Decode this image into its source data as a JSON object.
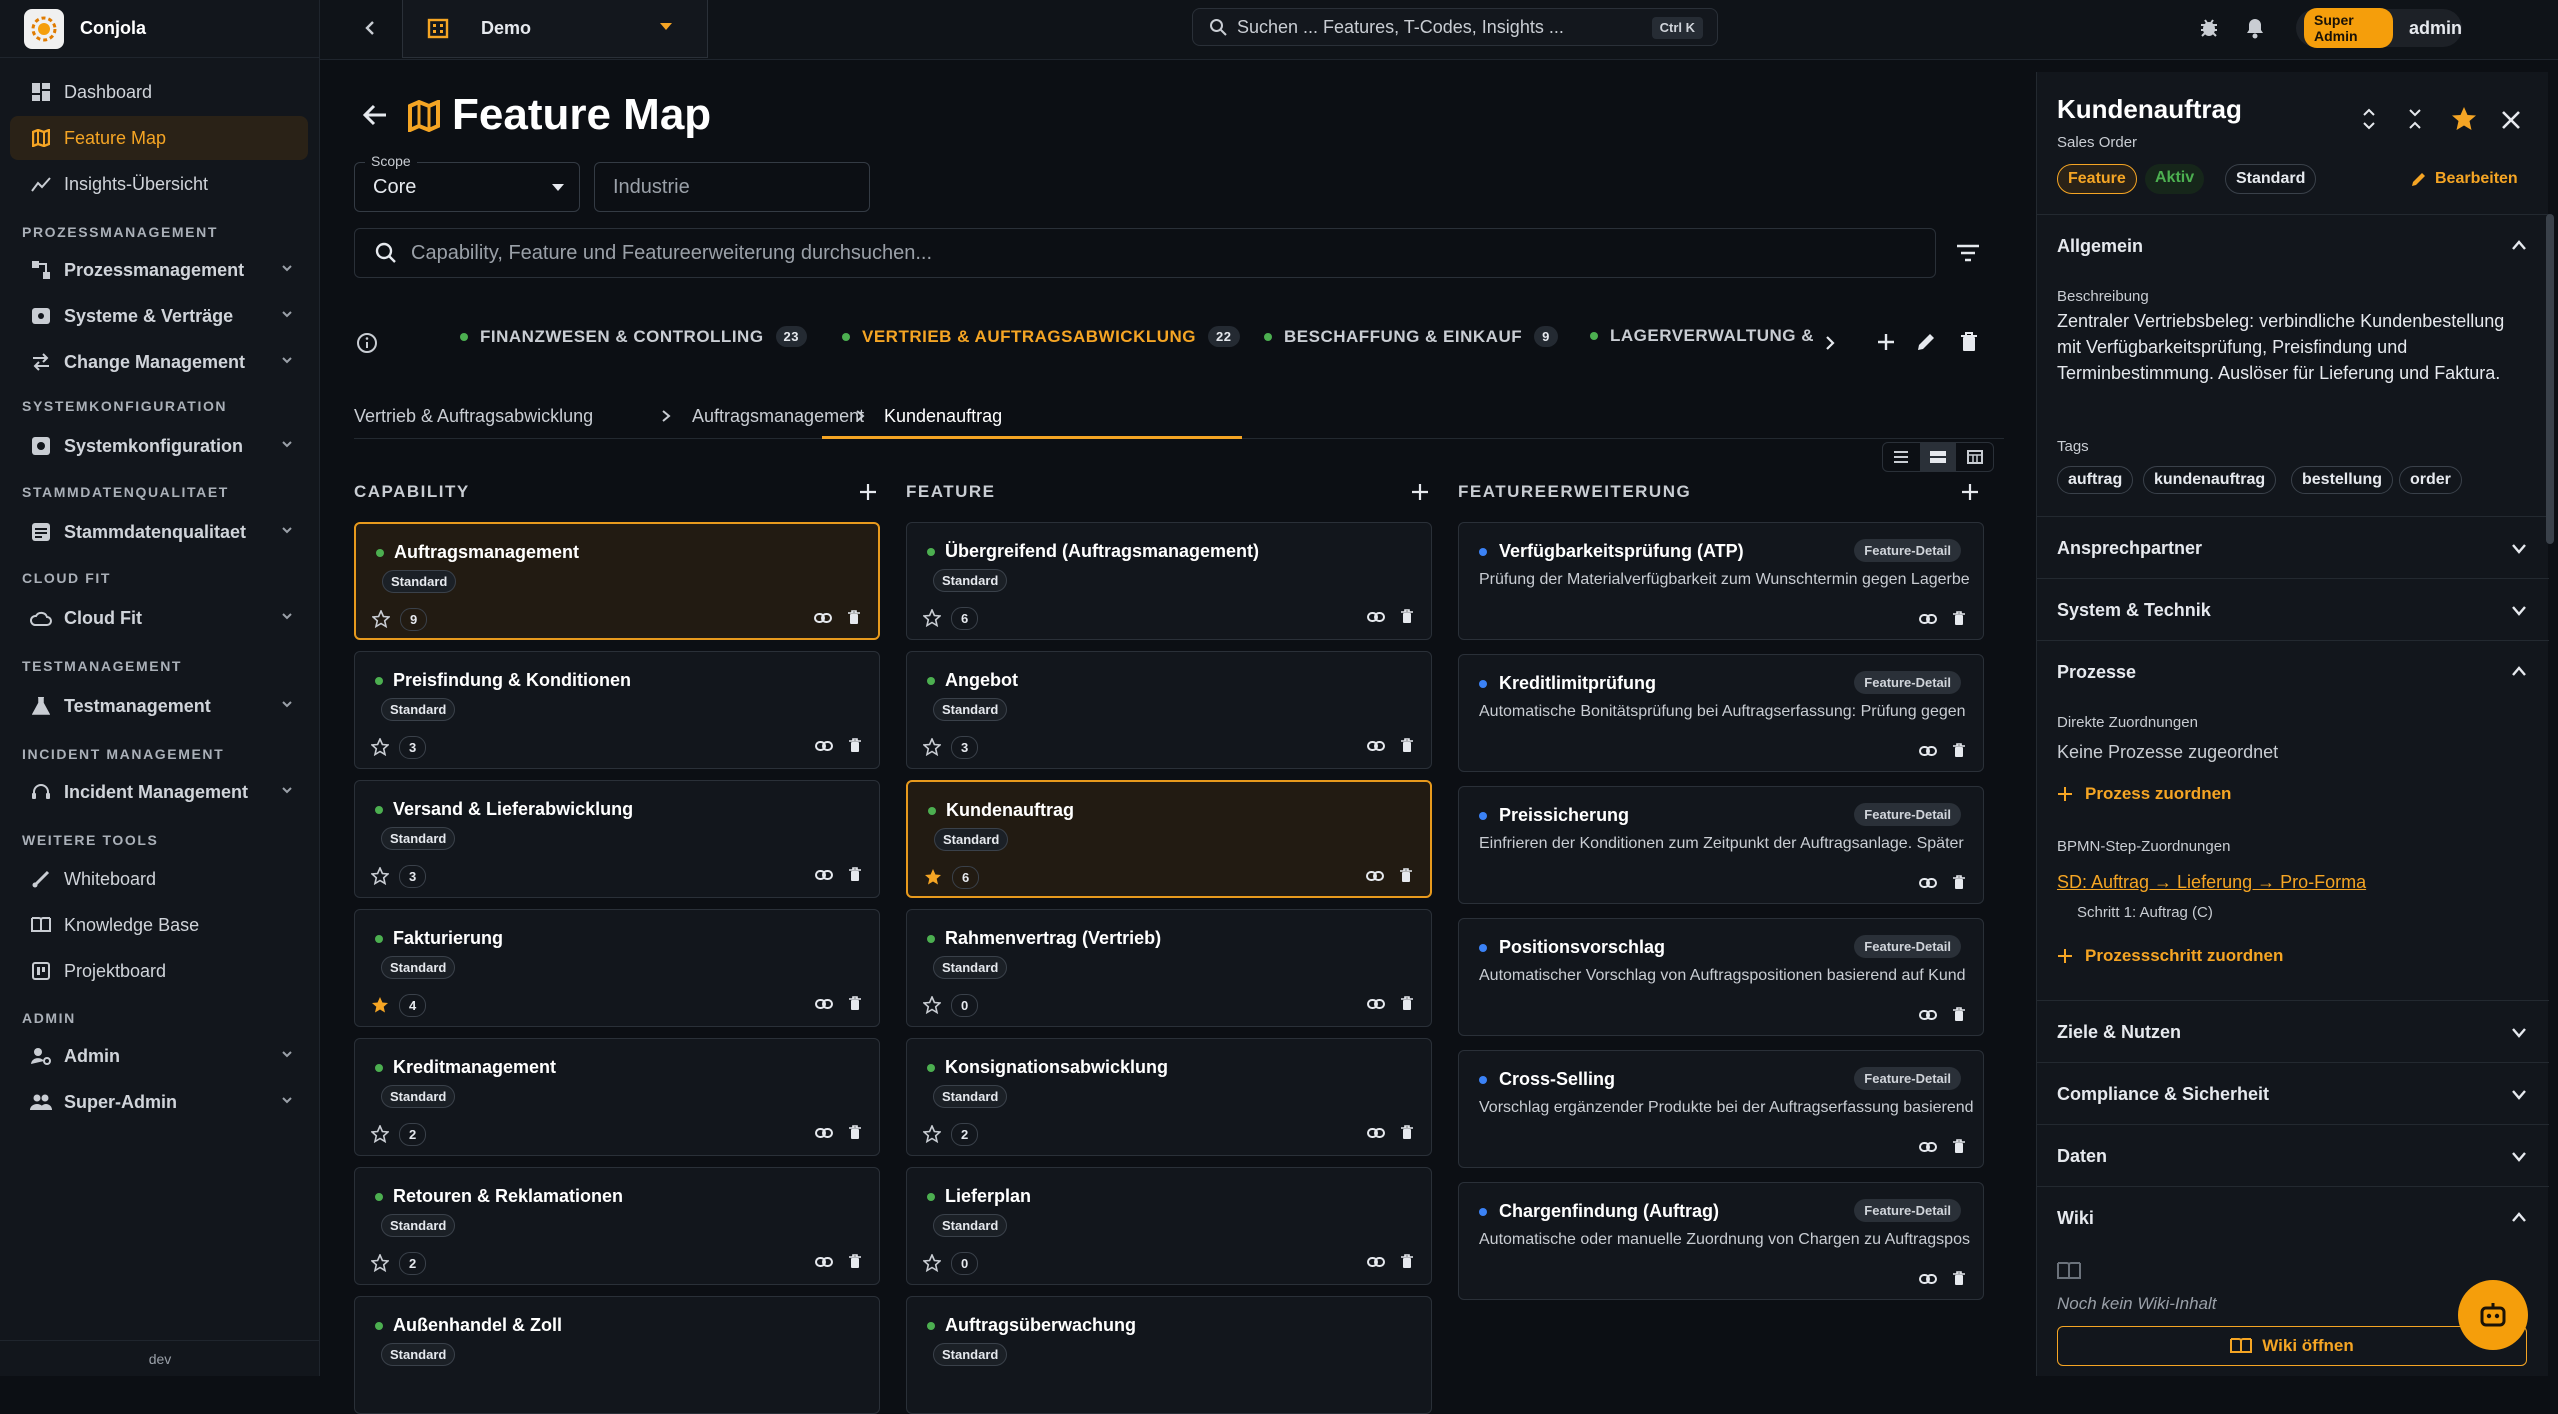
{
  "app": {
    "brand": "Conjola",
    "env": "dev"
  },
  "sidebar": {
    "top": [
      {
        "label": "Dashboard",
        "icon": "dashboard-icon"
      },
      {
        "label": "Feature Map",
        "icon": "map-icon"
      },
      {
        "label": "Insights-Übersicht",
        "icon": "chart-line-icon"
      }
    ],
    "sections": [
      {
        "title": "PROZESSMANAGEMENT",
        "item": "Prozessmanagement"
      },
      {
        "title": "",
        "item": "Systeme & Verträge"
      },
      {
        "title": "",
        "item": "Change Management"
      },
      {
        "title": "SYSTEMKONFIGURATION",
        "item": "Systemkonfiguration"
      },
      {
        "title": "STAMMDATENQUALITAET",
        "item": "Stammdatenqualitaet"
      },
      {
        "title": "CLOUD FIT",
        "item": "Cloud Fit"
      },
      {
        "title": "TESTMANAGEMENT",
        "item": "Testmanagement"
      },
      {
        "title": "INCIDENT MANAGEMENT",
        "item": "Incident Management"
      }
    ],
    "tools_title": "WEITERE TOOLS",
    "tools": [
      "Whiteboard",
      "Knowledge Base",
      "Projektboard"
    ],
    "admin_title": "ADMIN",
    "admin": [
      "Admin",
      "Super-Admin"
    ]
  },
  "topbar": {
    "workspace": "Demo",
    "search_placeholder": "Suchen ... Features, T-Codes, Insights ...",
    "shortcut": "Ctrl K",
    "role": "Super Admin",
    "user": "admin"
  },
  "page": {
    "title": "Feature Map",
    "scope_label": "Scope",
    "scope_value": "Core",
    "industry_placeholder": "Industrie",
    "search_placeholder": "Capability, Feature und Featureerweiterung durchsuchen...",
    "tabs": [
      {
        "label": "FINANZWESEN & CONTROLLING",
        "count": "23"
      },
      {
        "label": "VERTRIEB & AUFTRAGSABWICKLUNG",
        "count": "22"
      },
      {
        "label": "BESCHAFFUNG & EINKAUF",
        "count": "9"
      },
      {
        "label": "LAGERVERWALTUNG &",
        "count": ""
      }
    ],
    "breadcrumb": [
      "Vertrieb & Auftragsabwicklung",
      "Auftragsmanagement",
      "Kundenauftrag"
    ],
    "columns": {
      "capability": "CAPABILITY",
      "feature": "FEATURE",
      "extension": "FEATUREERWEITERUNG"
    },
    "standard_label": "Standard",
    "feature_detail_label": "Feature-Detail"
  },
  "capabilities": [
    {
      "name": "Auftragsmanagement",
      "count": "9",
      "starred": false
    },
    {
      "name": "Preisfindung & Konditionen",
      "count": "3",
      "starred": false
    },
    {
      "name": "Versand & Lieferabwicklung",
      "count": "3",
      "starred": false
    },
    {
      "name": "Fakturierung",
      "count": "4",
      "starred": true
    },
    {
      "name": "Kreditmanagement",
      "count": "2",
      "starred": false
    },
    {
      "name": "Retouren & Reklamationen",
      "count": "2",
      "starred": false
    },
    {
      "name": "Außenhandel & Zoll",
      "count": "",
      "starred": false
    }
  ],
  "features": [
    {
      "name": "Übergreifend (Auftragsmanagement)",
      "count": "6",
      "starred": false
    },
    {
      "name": "Angebot",
      "count": "3",
      "starred": false
    },
    {
      "name": "Kundenauftrag",
      "count": "6",
      "starred": true
    },
    {
      "name": "Rahmenvertrag (Vertrieb)",
      "count": "0",
      "starred": false
    },
    {
      "name": "Konsignationsabwicklung",
      "count": "2",
      "starred": false
    },
    {
      "name": "Lieferplan",
      "count": "0",
      "starred": false
    },
    {
      "name": "Auftragsüberwachung",
      "count": "",
      "starred": false
    }
  ],
  "extensions": [
    {
      "name": "Verfügbarkeitsprüfung (ATP)",
      "desc": "Prüfung der Materialverfügbarkeit zum Wunschtermin gegen Lagerbe"
    },
    {
      "name": "Kreditlimitprüfung",
      "desc": "Automatische Bonitätsprüfung bei Auftragserfassung: Prüfung gegen"
    },
    {
      "name": "Preissicherung",
      "desc": "Einfrieren der Konditionen zum Zeitpunkt der Auftragsanlage. Später"
    },
    {
      "name": "Positionsvorschlag",
      "desc": "Automatischer Vorschlag von Auftragspositionen basierend auf Kund"
    },
    {
      "name": "Cross-Selling",
      "desc": "Vorschlag ergänzender Produkte bei der Auftragserfassung basierend"
    },
    {
      "name": "Chargenfindung (Auftrag)",
      "desc": "Automatische oder manuelle Zuordnung von Chargen zu Auftragspos"
    }
  ],
  "panel": {
    "title": "Kundenauftrag",
    "subtitle": "Sales Order",
    "chips": [
      "Feature",
      "Aktiv",
      "Standard"
    ],
    "edit": "Bearbeiten",
    "general": "Allgemein",
    "desc_label": "Beschreibung",
    "desc": "Zentraler Vertriebsbeleg: verbindliche Kundenbestellung mit Verfügbarkeitsprüfung, Preisfindung und Terminbestimmung. Auslöser für Lieferung und Faktura.",
    "tags_label": "Tags",
    "tags": [
      "auftrag",
      "kundenauftrag",
      "bestellung",
      "order"
    ],
    "contact": "Ansprechpartner",
    "system": "System & Technik",
    "processes": "Prozesse",
    "direct_label": "Direkte Zuordnungen",
    "no_processes": "Keine Prozesse zugeordnet",
    "assign_process": "Prozess zuordnen",
    "bpmn_label": "BPMN-Step-Zuordnungen",
    "bpmn_link": "SD: Auftrag → Lieferung → Pro-Forma",
    "bpmn_step": "Schritt 1: Auftrag (C)",
    "assign_step": "Prozessschritt zuordnen",
    "goals": "Ziele & Nutzen",
    "compliance": "Compliance & Sicherheit",
    "data": "Daten",
    "wiki": "Wiki",
    "no_wiki": "Noch kein Wiki-Inhalt",
    "open_wiki": "Wiki öffnen"
  },
  "colors": {
    "accent": "#f5a524",
    "active_dot": "#4caf50",
    "extension_dot": "#3b82f6"
  }
}
